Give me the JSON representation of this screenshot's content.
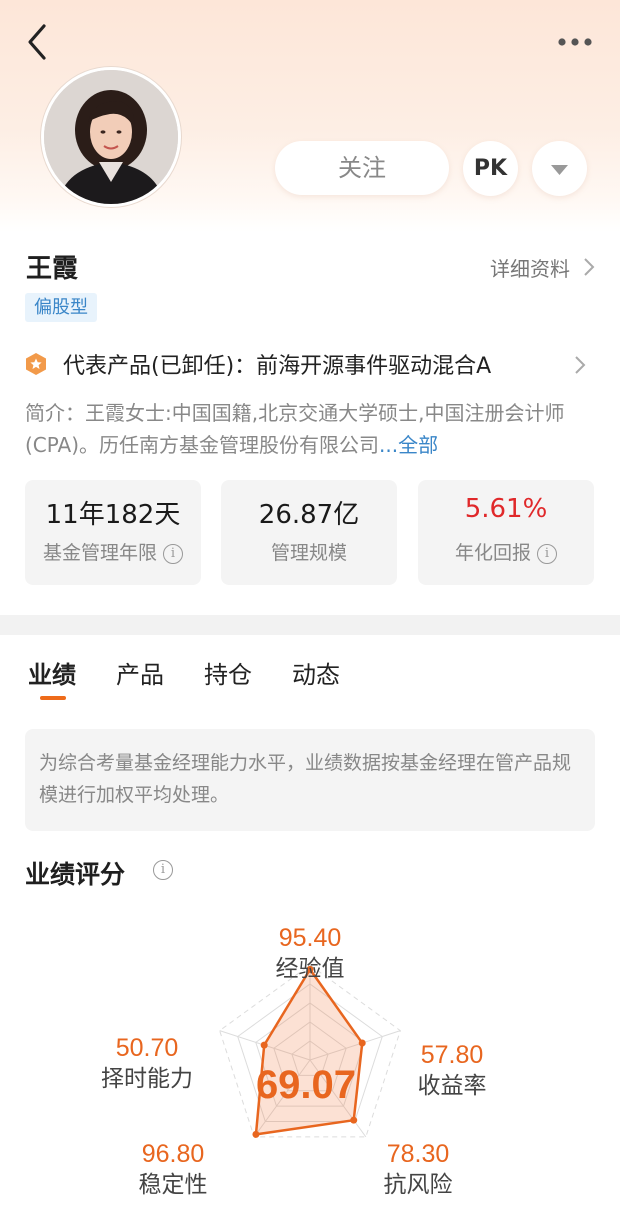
{
  "header": {
    "follow_label": "关注",
    "pk_label": "PK"
  },
  "manager": {
    "name": "王霞",
    "detail_link": "详细资料",
    "style_tag": "偏股型",
    "product": "代表产品(已卸任)：前海开源事件驱动混合A",
    "intro_text": "简介：王霞女士:中国国籍,北京交通大学硕士,中国注册会计师(CPA)。历任南方基金管理股份有限公司",
    "intro_more": "...全部"
  },
  "stats": [
    {
      "value": "11年182天",
      "label": "基金管理年限",
      "has_info": true
    },
    {
      "value": "26.87亿",
      "label": "管理规模",
      "has_info": false
    },
    {
      "value": "5.61%",
      "label": "年化回报",
      "has_info": true
    }
  ],
  "tabs": [
    "业绩",
    "产品",
    "持仓",
    "动态"
  ],
  "notice": "为综合考量基金经理能力水平，业绩数据按基金经理在管产品规模进行加权平均处理。",
  "score_section": {
    "title": "业绩评分",
    "total": "69.07",
    "dimensions": [
      {
        "label": "经验值",
        "value": "95.40",
        "score": 95.4
      },
      {
        "label": "收益率",
        "value": "57.80",
        "score": 57.8
      },
      {
        "label": "抗风险",
        "value": "78.30",
        "score": 78.3
      },
      {
        "label": "稳定性",
        "value": "96.80",
        "score": 96.8
      },
      {
        "label": "择时能力",
        "value": "50.70",
        "score": 50.7
      }
    ]
  },
  "colors": {
    "accent": "#e8661f",
    "return_red": "#e0282a",
    "tag_blue": "#3a86c8"
  }
}
